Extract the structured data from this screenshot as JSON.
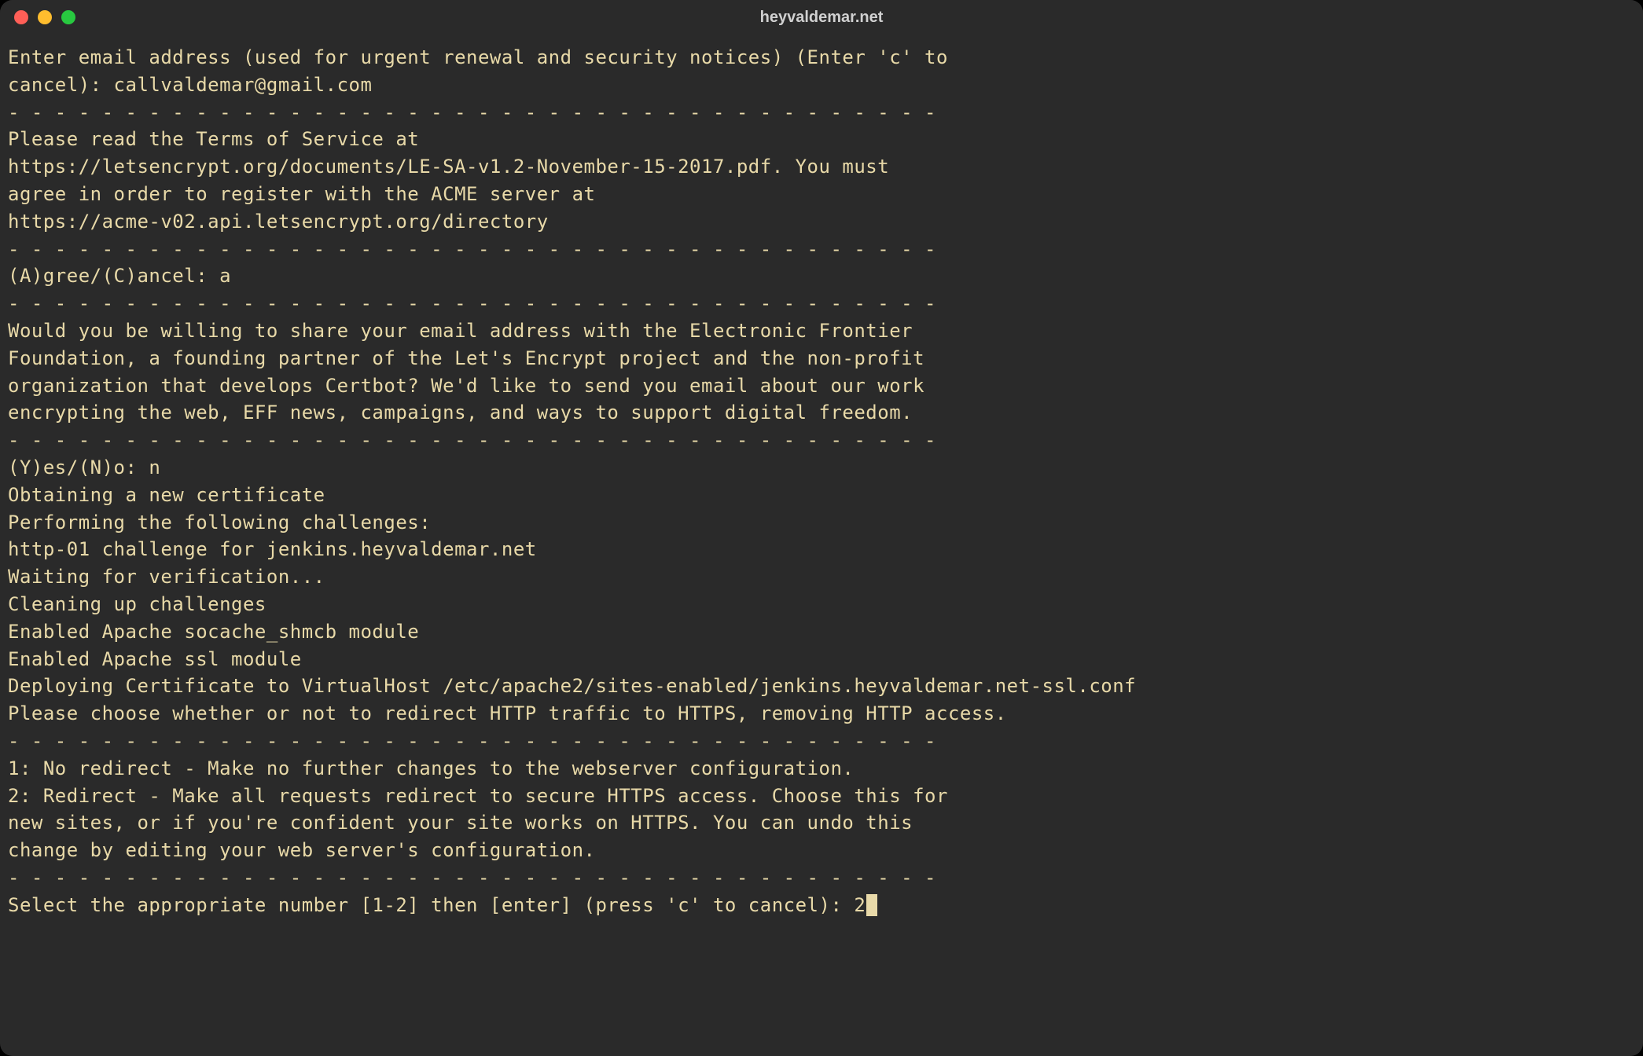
{
  "window": {
    "title": "heyvaldemar.net"
  },
  "terminal": {
    "lines": [
      "Enter email address (used for urgent renewal and security notices) (Enter 'c' to",
      "cancel): callvaldemar@gmail.com",
      "",
      "- - - - - - - - - - - - - - - - - - - - - - - - - - - - - - - - - - - - - - - -",
      "Please read the Terms of Service at",
      "https://letsencrypt.org/documents/LE-SA-v1.2-November-15-2017.pdf. You must",
      "agree in order to register with the ACME server at",
      "https://acme-v02.api.letsencrypt.org/directory",
      "- - - - - - - - - - - - - - - - - - - - - - - - - - - - - - - - - - - - - - - -",
      "(A)gree/(C)ancel: a",
      "",
      "- - - - - - - - - - - - - - - - - - - - - - - - - - - - - - - - - - - - - - - -",
      "Would you be willing to share your email address with the Electronic Frontier",
      "Foundation, a founding partner of the Let's Encrypt project and the non-profit",
      "organization that develops Certbot? We'd like to send you email about our work",
      "encrypting the web, EFF news, campaigns, and ways to support digital freedom.",
      "- - - - - - - - - - - - - - - - - - - - - - - - - - - - - - - - - - - - - - - -",
      "(Y)es/(N)o: n",
      "Obtaining a new certificate",
      "Performing the following challenges:",
      "http-01 challenge for jenkins.heyvaldemar.net",
      "Waiting for verification...",
      "Cleaning up challenges",
      "Enabled Apache socache_shmcb module",
      "Enabled Apache ssl module",
      "Deploying Certificate to VirtualHost /etc/apache2/sites-enabled/jenkins.heyvaldemar.net-ssl.conf",
      "",
      "Please choose whether or not to redirect HTTP traffic to HTTPS, removing HTTP access.",
      "- - - - - - - - - - - - - - - - - - - - - - - - - - - - - - - - - - - - - - - -",
      "1: No redirect - Make no further changes to the webserver configuration.",
      "2: Redirect - Make all requests redirect to secure HTTPS access. Choose this for",
      "new sites, or if you're confident your site works on HTTPS. You can undo this",
      "change by editing your web server's configuration.",
      "- - - - - - - - - - - - - - - - - - - - - - - - - - - - - - - - - - - - - - - -"
    ],
    "prompt": "Select the appropriate number [1-2] then [enter] (press 'c' to cancel): ",
    "input_value": "2"
  }
}
